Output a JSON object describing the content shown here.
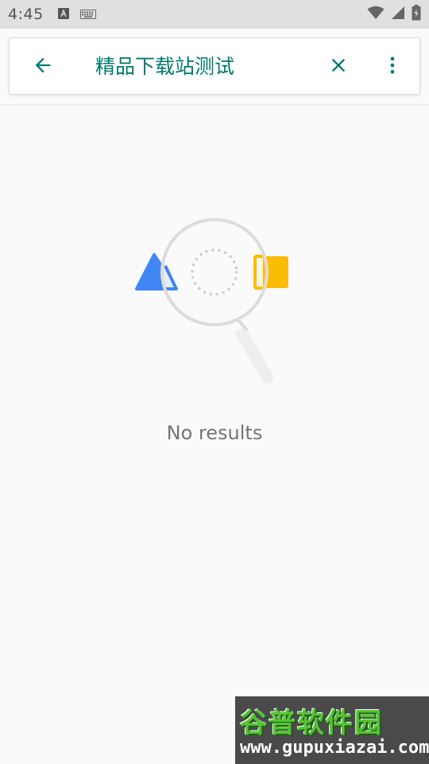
{
  "status_bar": {
    "time": "4:45",
    "icons": [
      "text-a-icon",
      "keyboard-icon",
      "wifi-icon",
      "signal-icon",
      "battery-icon"
    ]
  },
  "search_bar": {
    "query": "精品下载站测试",
    "back_icon": "arrow-left-icon",
    "clear_icon": "close-icon",
    "more_icon": "more-vertical-icon"
  },
  "main": {
    "empty_message": "No results",
    "illustration": "magnifier-no-results-icon"
  },
  "watermark": {
    "title": "谷普软件园",
    "url": "www.gupuxiazai.com"
  },
  "colors": {
    "accent": "#00796b",
    "background": "#fafafa",
    "status_bar": "#e0e0e0",
    "empty_text": "#757575",
    "shape_blue": "#4285f4",
    "shape_yellow": "#fbbc04"
  }
}
